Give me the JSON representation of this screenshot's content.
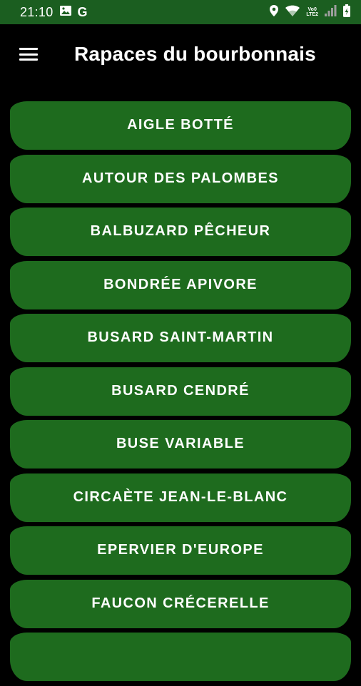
{
  "status_bar": {
    "time": "21:10",
    "g_label": "G",
    "volte_line1": "Vo0",
    "volte_line2": "LTE2",
    "icons_left": [
      "image-icon",
      "google-icon"
    ],
    "icons_right": [
      "location-icon",
      "wifi-icon",
      "volte-icon",
      "signal-icon",
      "battery-icon"
    ]
  },
  "app_bar": {
    "title": "Rapaces du bourbonnais",
    "menu_icon": "hamburger-menu-icon"
  },
  "colors": {
    "status_bar_bg": "#1b5e20",
    "app_bar_bg": "#000000",
    "button_bg": "#1e6b1e",
    "text": "#ffffff"
  },
  "birds": [
    "AIGLE BOTTÉ",
    "AUTOUR DES PALOMBES",
    "BALBUZARD PÊCHEUR",
    "BONDRÉE APIVORE",
    "BUSARD SAINT-MARTIN",
    "BUSARD CENDRÉ",
    "BUSE VARIABLE",
    "CIRCAÈTE JEAN-LE-BLANC",
    "EPERVIER D'EUROPE",
    "FAUCON CRÉCERELLE",
    ""
  ]
}
